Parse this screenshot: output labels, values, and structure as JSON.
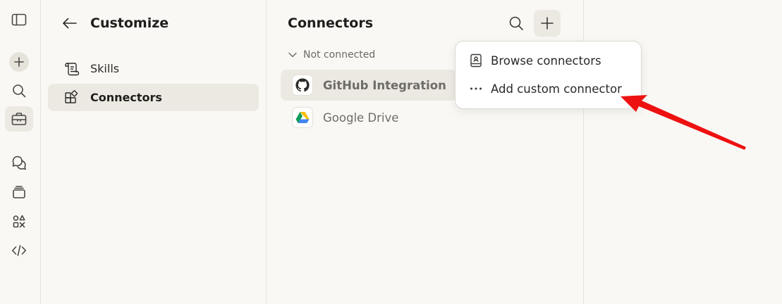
{
  "customize_panel": {
    "title": "Customize",
    "nav": [
      {
        "label": "Skills",
        "icon": "scroll-icon"
      },
      {
        "label": "Connectors",
        "icon": "connectors-icon",
        "active": true
      }
    ]
  },
  "connectors_panel": {
    "title": "Connectors",
    "section_label": "Not connected",
    "items": [
      {
        "label": "GitHub Integration",
        "icon": "github-icon"
      },
      {
        "label": "Google Drive",
        "icon": "google-drive-icon"
      }
    ]
  },
  "add_menu": {
    "items": [
      {
        "label": "Browse connectors",
        "icon": "book-icon"
      },
      {
        "label": "Add custom connector",
        "icon": "more-dots-icon"
      }
    ]
  },
  "colors": {
    "background": "#f9f8f5",
    "active_bg": "#ece9e2",
    "annotation_arrow": "#ee1111"
  }
}
